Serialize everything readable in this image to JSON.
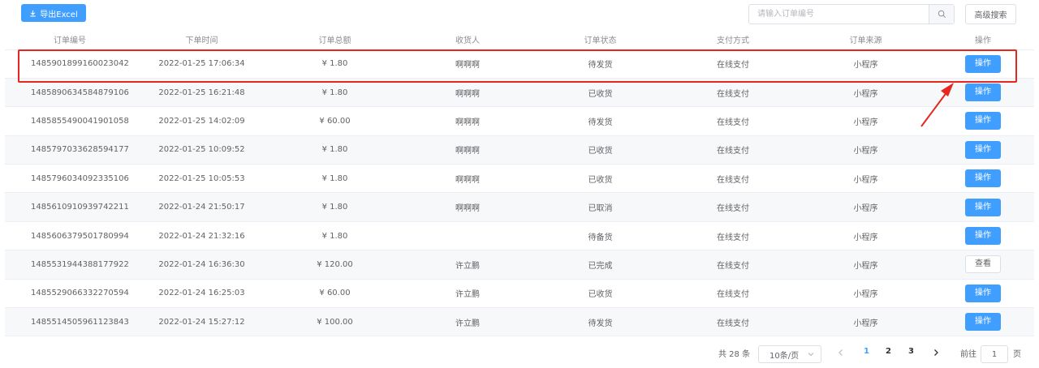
{
  "toolbar": {
    "export_label": "导出Excel",
    "search_placeholder": "请输入订单编号",
    "advanced_search_label": "高级搜索"
  },
  "table": {
    "columns": [
      "订单编号",
      "下单时间",
      "订单总额",
      "收货人",
      "订单状态",
      "支付方式",
      "订单来源",
      "操作"
    ],
    "rows": [
      {
        "order_no": "1485901899160023042",
        "time": "2022-01-25 17:06:34",
        "amount": "¥ 1.80",
        "receiver": "啊啊啊",
        "status": "待发货",
        "payment": "在线支付",
        "source": "小程序",
        "action": "操作"
      },
      {
        "order_no": "1485890634584879106",
        "time": "2022-01-25 16:21:48",
        "amount": "¥ 1.80",
        "receiver": "啊啊啊",
        "status": "已收货",
        "payment": "在线支付",
        "source": "小程序",
        "action": "操作"
      },
      {
        "order_no": "1485855490041901058",
        "time": "2022-01-25 14:02:09",
        "amount": "¥ 60.00",
        "receiver": "啊啊啊",
        "status": "待发货",
        "payment": "在线支付",
        "source": "小程序",
        "action": "操作"
      },
      {
        "order_no": "1485797033628594177",
        "time": "2022-01-25 10:09:52",
        "amount": "¥ 1.80",
        "receiver": "啊啊啊",
        "status": "已收货",
        "payment": "在线支付",
        "source": "小程序",
        "action": "操作"
      },
      {
        "order_no": "1485796034092335106",
        "time": "2022-01-25 10:05:53",
        "amount": "¥ 1.80",
        "receiver": "啊啊啊",
        "status": "已收货",
        "payment": "在线支付",
        "source": "小程序",
        "action": "操作"
      },
      {
        "order_no": "1485610910939742211",
        "time": "2022-01-24 21:50:17",
        "amount": "¥ 1.80",
        "receiver": "啊啊啊",
        "status": "已取消",
        "payment": "在线支付",
        "source": "小程序",
        "action": "操作"
      },
      {
        "order_no": "1485606379501780994",
        "time": "2022-01-24 21:32:16",
        "amount": "¥ 1.80",
        "receiver": "",
        "status": "待备货",
        "payment": "在线支付",
        "source": "小程序",
        "action": "操作"
      },
      {
        "order_no": "1485531944388177922",
        "time": "2022-01-24 16:36:30",
        "amount": "¥ 120.00",
        "receiver": "许立鹏",
        "status": "已完成",
        "payment": "在线支付",
        "source": "小程序",
        "action": "查看"
      },
      {
        "order_no": "1485529066332270594",
        "time": "2022-01-24 16:25:03",
        "amount": "¥ 60.00",
        "receiver": "许立鹏",
        "status": "已收货",
        "payment": "在线支付",
        "source": "小程序",
        "action": "操作"
      },
      {
        "order_no": "1485514505961123843",
        "time": "2022-01-24 15:27:12",
        "amount": "¥ 100.00",
        "receiver": "许立鹏",
        "status": "待发货",
        "payment": "在线支付",
        "source": "小程序",
        "action": "操作"
      }
    ]
  },
  "pagination": {
    "total_text": "共 28 条",
    "page_size": "10条/页",
    "pages": [
      "1",
      "2",
      "3"
    ],
    "current_page": "1",
    "goto_label": "前往",
    "goto_value": "1",
    "page_unit": "页"
  },
  "colors": {
    "primary": "#409eff",
    "highlight": "#e8251f"
  }
}
